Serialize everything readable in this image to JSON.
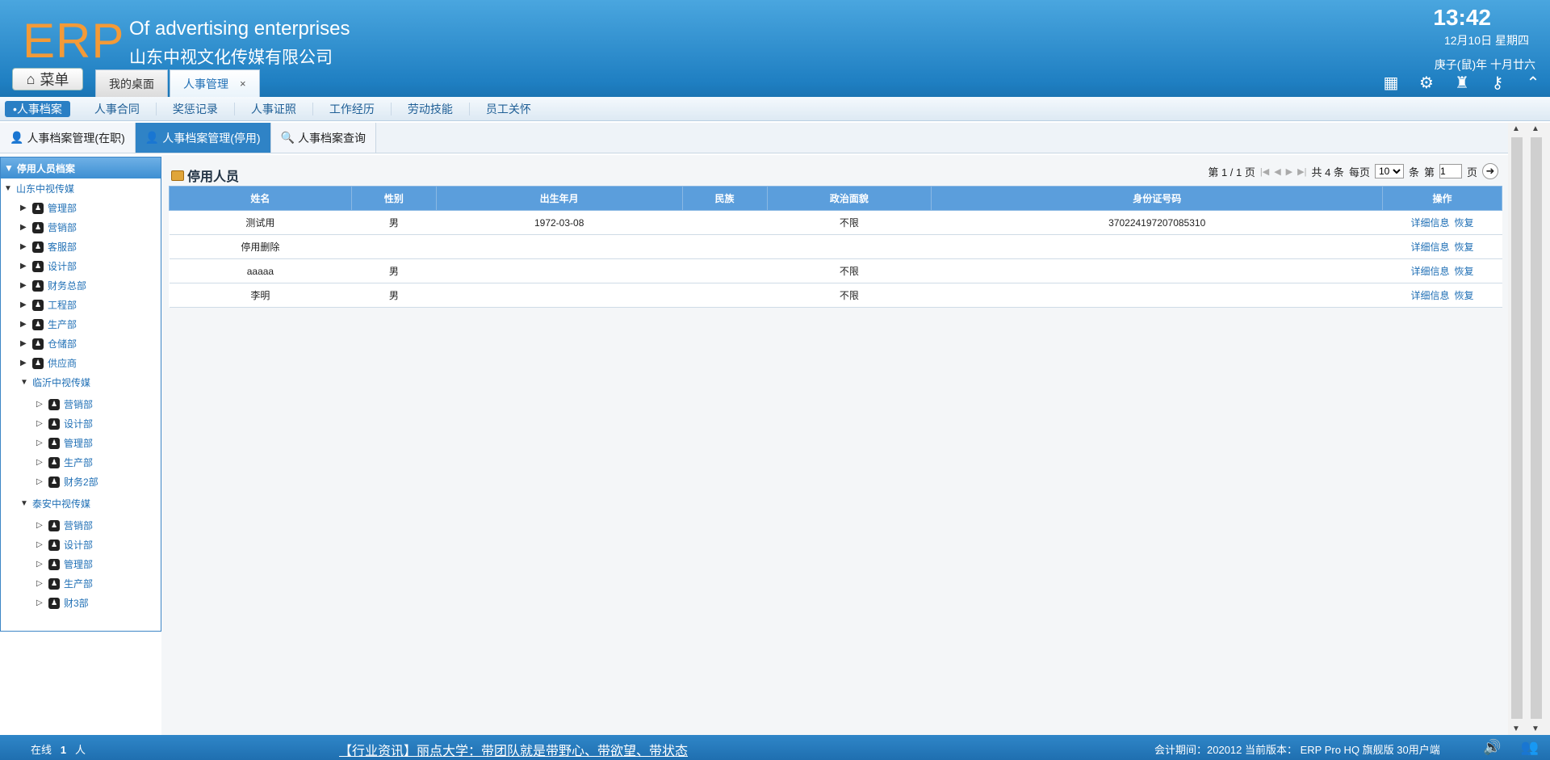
{
  "header": {
    "logo": "ERP",
    "brand_en": "Of advertising enterprises",
    "brand_cn": "山东中视文化传媒有限公司",
    "time": "13:42",
    "date": "12月10日 星期四",
    "lunar": "庚子(鼠)年 十月廿六",
    "menu_label": "菜单",
    "tabs": [
      {
        "label": "我的桌面"
      },
      {
        "label": "人事管理",
        "close": "×"
      }
    ],
    "tool_icons": [
      "grid-add-icon",
      "gear-icon",
      "shirt-icon",
      "key-icon",
      "collapse-up-icon"
    ]
  },
  "subnav": {
    "items": [
      "•人事档案",
      "人事合同",
      "奖惩记录",
      "人事证照",
      "工作经历",
      "劳动技能",
      "员工关怀"
    ]
  },
  "function_tabs": [
    {
      "label": "人事档案管理(在职)"
    },
    {
      "label": "人事档案管理(停用)"
    },
    {
      "label": "人事档案查询"
    }
  ],
  "tree": {
    "title": "停用人员档案",
    "nodes": [
      {
        "label": "山东中视传媒",
        "level": 0,
        "expanded": true,
        "company": true
      },
      {
        "label": "管理部",
        "level": 1
      },
      {
        "label": "营销部",
        "level": 1
      },
      {
        "label": "客服部",
        "level": 1
      },
      {
        "label": "设计部",
        "level": 1
      },
      {
        "label": "财务总部",
        "level": 1
      },
      {
        "label": "工程部",
        "level": 1
      },
      {
        "label": "生产部",
        "level": 1
      },
      {
        "label": "仓储部",
        "level": 1
      },
      {
        "label": "供应商",
        "level": 1
      },
      {
        "label": "临沂中视传媒",
        "level": 1,
        "expanded": true,
        "company": true
      },
      {
        "label": "营销部",
        "level": 2
      },
      {
        "label": "设计部",
        "level": 2
      },
      {
        "label": "管理部",
        "level": 2
      },
      {
        "label": "生产部",
        "level": 2
      },
      {
        "label": "财务2部",
        "level": 2
      },
      {
        "label": "泰安中视传媒",
        "level": 1,
        "expanded": true,
        "company": true
      },
      {
        "label": "营销部",
        "level": 2
      },
      {
        "label": "设计部",
        "level": 2
      },
      {
        "label": "管理部",
        "level": 2
      },
      {
        "label": "生产部",
        "level": 2
      },
      {
        "label": "财3部",
        "level": 2
      }
    ]
  },
  "main": {
    "title": "停用人员",
    "pager": {
      "page_info": "第 1 / 1 页",
      "total": "共 4 条",
      "per_page_label": "每页",
      "per_page": "10",
      "unit": "条",
      "goto_label": "第",
      "goto_value": "1",
      "page_suffix": "页"
    },
    "columns": [
      "姓名",
      "性别",
      "出生年月",
      "民族",
      "政治面貌",
      "身份证号码",
      "操作"
    ],
    "rows": [
      {
        "name": "测试用",
        "gender": "男",
        "birth": "1972-03-08",
        "ethnic": "",
        "political": "不限",
        "id": "370224197207085310"
      },
      {
        "name": "停用删除",
        "gender": "",
        "birth": "",
        "ethnic": "",
        "political": "",
        "id": ""
      },
      {
        "name": "aaaaa",
        "gender": "男",
        "birth": "",
        "ethnic": "",
        "political": "不限",
        "id": ""
      },
      {
        "name": "李明",
        "gender": "男",
        "birth": "",
        "ethnic": "",
        "political": "不限",
        "id": ""
      }
    ],
    "op_detail": "详细信息",
    "op_restore": "恢复"
  },
  "footer": {
    "online_label": "在线",
    "online_count": "1",
    "online_unit": "人",
    "news": "【行业资讯】丽点大学：带团队就是带野心、带欲望、带状态",
    "info": "会计期间：202012 当前版本： ERP Pro HQ 旗舰版 30用户端"
  },
  "colors": {
    "header_blue": "#2a88cc",
    "logo_orange": "#f39a37",
    "table_head": "#5b9edc",
    "link_blue": "#1f6fb5",
    "arrow_red": "#e8312b"
  }
}
